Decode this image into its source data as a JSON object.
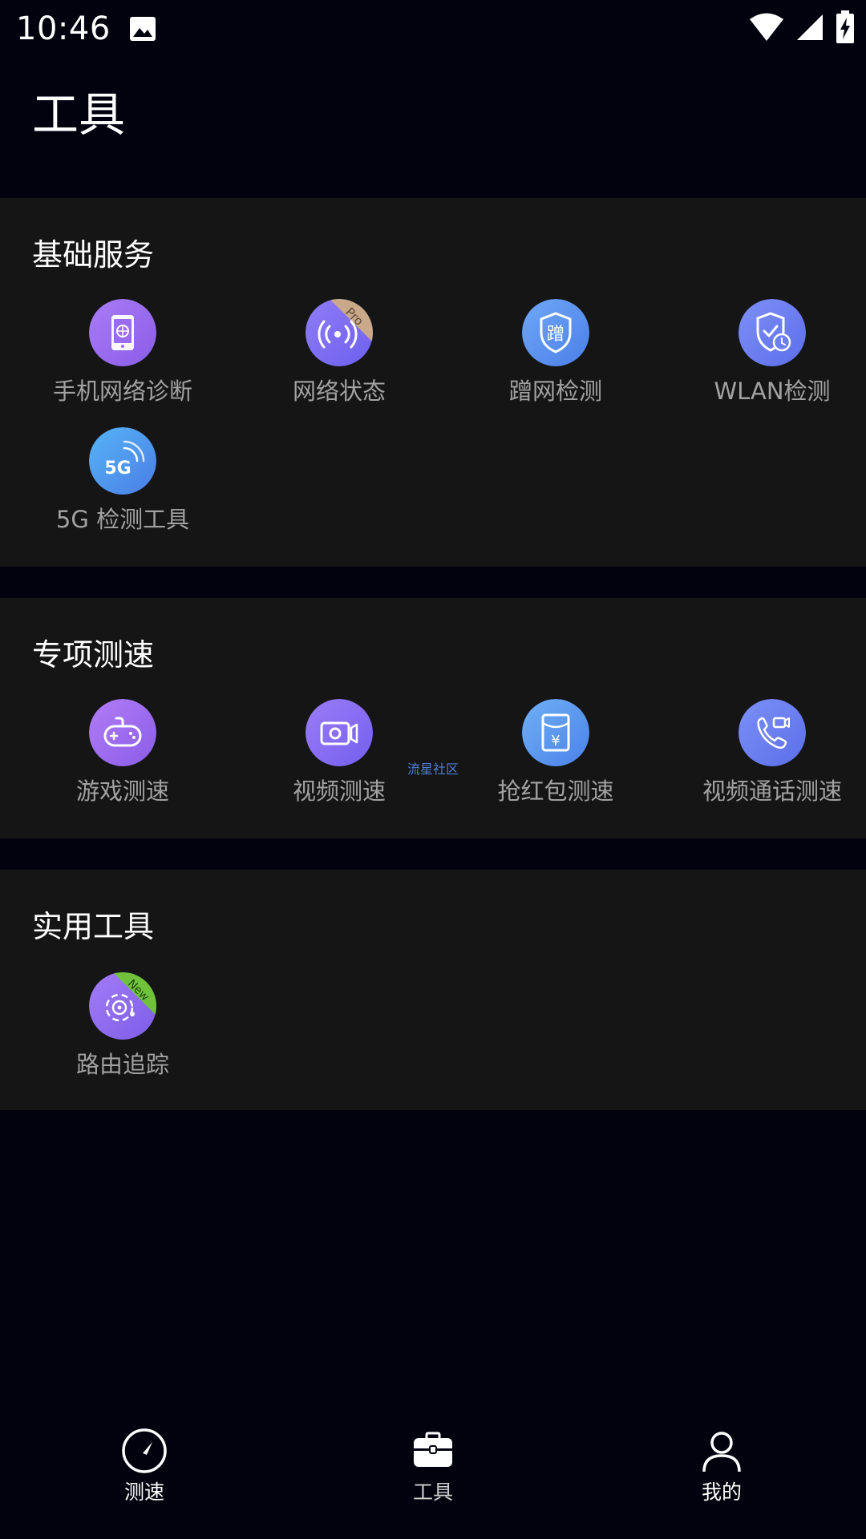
{
  "status_bar": {
    "time": "10:46",
    "icons": [
      "gallery-icon",
      "wifi-icon",
      "cellular-signal-icon",
      "battery-charging-icon"
    ]
  },
  "page": {
    "title": "工具"
  },
  "sections": [
    {
      "title": "基础服务",
      "items": [
        {
          "label": "手机网络诊断",
          "icon": "phone-network-diagnosis-icon"
        },
        {
          "label": "网络状态",
          "icon": "network-status-icon",
          "badge": "Pro"
        },
        {
          "label": "蹭网检测",
          "icon": "freeloader-shield-icon",
          "glyph": "蹭"
        },
        {
          "label": "WLAN检测",
          "icon": "wlan-shield-check-icon"
        },
        {
          "label": "5G 检测工具",
          "icon": "5g-icon",
          "glyph": "5G"
        }
      ]
    },
    {
      "title": "专项测速",
      "items": [
        {
          "label": "游戏测速",
          "icon": "gamepad-icon"
        },
        {
          "label": "视频测速",
          "icon": "video-camera-icon"
        },
        {
          "label": "抢红包测速",
          "icon": "red-envelope-icon",
          "glyph": "¥"
        },
        {
          "label": "视频通话测速",
          "icon": "video-call-icon"
        }
      ]
    },
    {
      "title": "实用工具",
      "items": [
        {
          "label": "路由追踪",
          "icon": "route-trace-icon",
          "badge": "New"
        }
      ]
    }
  ],
  "watermark": "流星社区",
  "bottom_nav": {
    "items": [
      {
        "label": "测速",
        "icon": "speedometer-icon"
      },
      {
        "label": "工具",
        "icon": "toolbox-icon",
        "active": true
      },
      {
        "label": "我的",
        "icon": "user-profile-icon"
      }
    ]
  },
  "colors": {
    "background": "#02020f",
    "section_bg": "#151515",
    "label_gray": "#a2a2a2",
    "icon_purple": "#9b6cf0",
    "icon_blue": "#5b8ef0",
    "pro_badge": "#c9a98a",
    "new_badge": "#6fc23a"
  }
}
